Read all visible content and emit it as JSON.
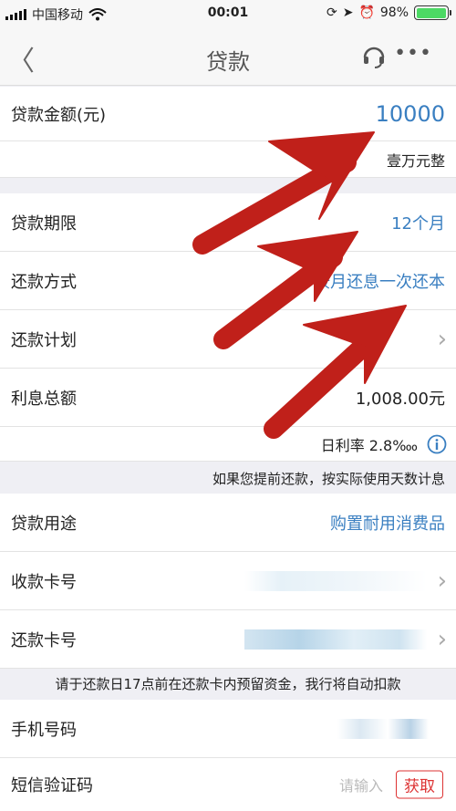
{
  "status": {
    "carrier": "中国移动",
    "time": "00:01",
    "battery": "98%",
    "battery_level": 0.98
  },
  "nav": {
    "title": "贷款"
  },
  "loan_amount": {
    "label": "贷款金额(元)",
    "value": "10000",
    "words": "壹万元整"
  },
  "term": {
    "label": "贷款期限",
    "value": "12个月"
  },
  "repay_method": {
    "label": "还款方式",
    "value": "按月还息一次还本"
  },
  "repay_plan": {
    "label": "还款计划"
  },
  "interest_total": {
    "label": "利息总额",
    "value": "1,008.00元",
    "rate": "日利率 2.8‱"
  },
  "notice_early": "如果您提前还款，按实际使用天数计息",
  "purpose": {
    "label": "贷款用途",
    "value": "购置耐用消费品"
  },
  "receive_card": {
    "label": "收款卡号"
  },
  "repay_card": {
    "label": "还款卡号"
  },
  "notice_deduct": "请于还款日17点前在还款卡内预留资金，我行将自动扣款",
  "phone": {
    "label": "手机号码"
  },
  "sms": {
    "label": "短信验证码",
    "placeholder": "请输入",
    "button": "获取"
  },
  "colors": {
    "link": "#3a7fc1",
    "arrow": "#c0201a",
    "battery": "#4cd964"
  }
}
